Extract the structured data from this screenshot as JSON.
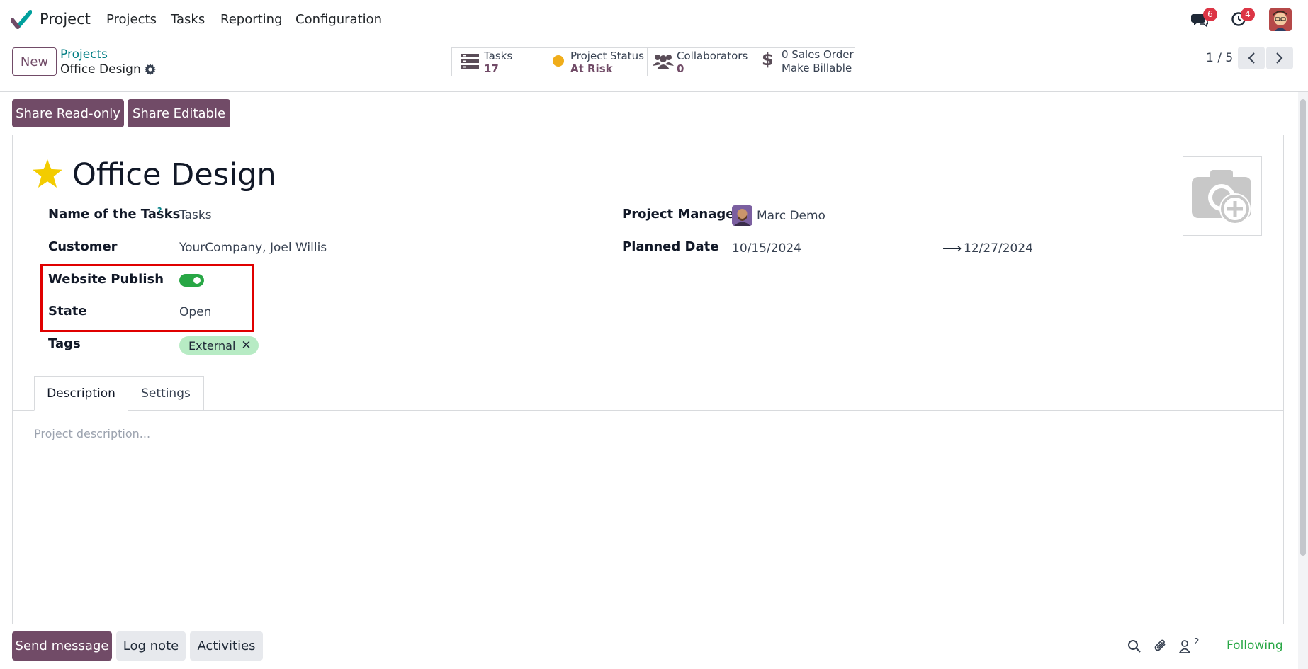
{
  "navbar": {
    "app_name": "Project",
    "menu": [
      "Projects",
      "Tasks",
      "Reporting",
      "Configuration"
    ],
    "messages_badge": "6",
    "activities_badge": "4"
  },
  "control": {
    "new_label": "New",
    "breadcrumb_parent": "Projects",
    "breadcrumb_current": "Office Design",
    "pager": "1 / 5"
  },
  "stats": {
    "tasks_label": "Tasks",
    "tasks_value": "17",
    "status_label": "Project Status",
    "status_value": "At Risk",
    "collaborators_label": "Collaborators",
    "collaborators_value": "0",
    "sales_line1": "0 Sales Order",
    "sales_line2": "Make Billable"
  },
  "share": {
    "readonly_label": "Share Read-only",
    "editable_label": "Share Editable"
  },
  "form": {
    "title": "Office Design",
    "name_of_tasks_label": "Name of the Tasks",
    "name_of_tasks_help": "?",
    "name_of_tasks_value": "Tasks",
    "customer_label": "Customer",
    "customer_value": "YourCompany, Joel Willis",
    "website_publish_label": "Website Publish",
    "website_publish_on": true,
    "state_label": "State",
    "state_value": "Open",
    "tags_label": "Tags",
    "tag": "External",
    "manager_label": "Project Manager",
    "manager_value": "Marc Demo",
    "planned_label": "Planned Date",
    "planned_start": "10/15/2024",
    "planned_end": "12/27/2024",
    "tabs": [
      "Description",
      "Settings"
    ],
    "description_placeholder": "Project description..."
  },
  "chatter": {
    "send_message": "Send message",
    "log_note": "Log note",
    "activities": "Activities",
    "followers_count": "2",
    "following": "Following"
  },
  "colors": {
    "primary": "#714b67",
    "link": "#017e84",
    "toggle_on": "#28a745",
    "highlight_box": "#e00000",
    "tag_bg": "#b7ebc4",
    "star": "#f3cc00"
  }
}
